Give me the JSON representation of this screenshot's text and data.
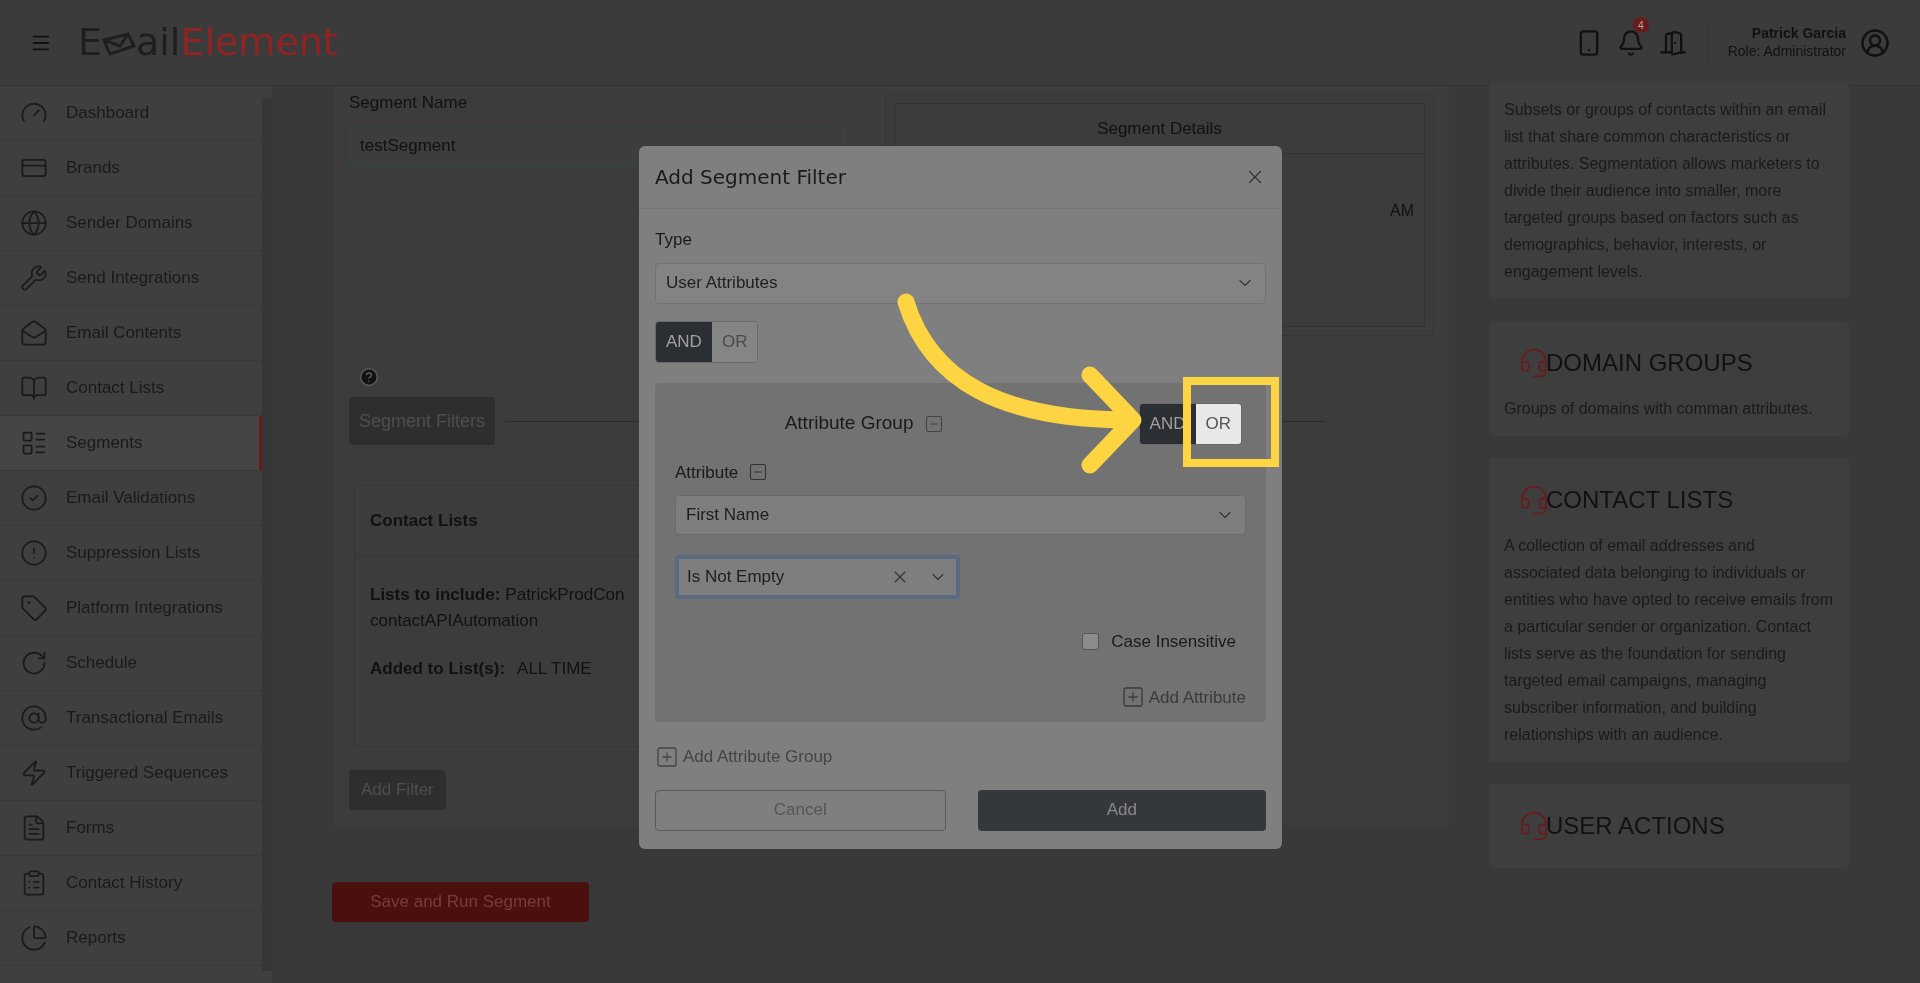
{
  "header": {
    "logo": {
      "lead": "E",
      "middle": "ail",
      "brand": "Element"
    },
    "notification_count": "4",
    "user": {
      "name": "Patrick Garcia",
      "role": "Role: Administrator"
    }
  },
  "sidebar": {
    "items": [
      {
        "label": "Dashboard",
        "selected": false
      },
      {
        "label": "Brands",
        "selected": false
      },
      {
        "label": "Sender Domains",
        "selected": false
      },
      {
        "label": "Send Integrations",
        "selected": false
      },
      {
        "label": "Email Contents",
        "selected": false
      },
      {
        "label": "Contact Lists",
        "selected": false
      },
      {
        "label": "Segments",
        "selected": true
      },
      {
        "label": "Email Validations",
        "selected": false
      },
      {
        "label": "Suppression Lists",
        "selected": false
      },
      {
        "label": "Platform Integrations",
        "selected": false
      },
      {
        "label": "Schedule",
        "selected": false
      },
      {
        "label": "Transactional Emails",
        "selected": false
      },
      {
        "label": "Triggered Sequences",
        "selected": false
      },
      {
        "label": "Forms",
        "selected": false
      },
      {
        "label": "Contact History",
        "selected": false
      },
      {
        "label": "Reports",
        "selected": false
      }
    ]
  },
  "segment_form": {
    "name_label": "Segment Name",
    "name_value": "testSegment",
    "details_title": "Segment Details",
    "details_fragment": "AM",
    "filters_label": "Segment Filters",
    "contact_lists": {
      "title": "Contact Lists",
      "include_label": "Lists to include:",
      "include_value": "PatrickProdCon",
      "include_value_2": "contactAPIAutomation",
      "added_label": "Added to List(s):",
      "added_value": "ALL TIME"
    },
    "add_filter": "Add Filter",
    "save_button": "Save and Run Segment"
  },
  "info_cards": [
    {
      "text": "Subsets or groups of contacts within an email list that share common characteristics or attributes. Segmentation allows marketers to divide their audience into smaller, more targeted groups based on factors such as demographics, behavior, interests, or engagement levels."
    },
    {
      "title": "DOMAIN GROUPS",
      "text": "Groups of domains with comman attributes."
    },
    {
      "title": "CONTACT LISTS",
      "text": "A collection of email addresses and associated data belonging to individuals or entities who have opted to receive emails from a particular sender or organization. Contact lists serve as the foundation for sending targeted email campaigns, managing subscriber information, and building relationships with an audience."
    },
    {
      "title": "USER ACTIONS"
    }
  ],
  "modal": {
    "title": "Add Segment Filter",
    "type_label": "Type",
    "type_value": "User Attributes",
    "logic": [
      {
        "label": "AND",
        "selected": true
      },
      {
        "label": "OR",
        "selected": false
      }
    ],
    "group": {
      "title": "Attribute Group",
      "logic": [
        {
          "label": "AND",
          "selected": true,
          "highlighted": false
        },
        {
          "label": "OR",
          "selected": false,
          "highlighted": true
        }
      ],
      "attribute_label": "Attribute",
      "attribute_value": "First Name",
      "operator_value": "Is Not Empty",
      "case_insensitive": {
        "label": "Case Insensitive",
        "checked": false
      },
      "add_attribute": "Add Attribute"
    },
    "add_group": "Add Attribute Group",
    "cancel": "Cancel",
    "add": "Add"
  }
}
